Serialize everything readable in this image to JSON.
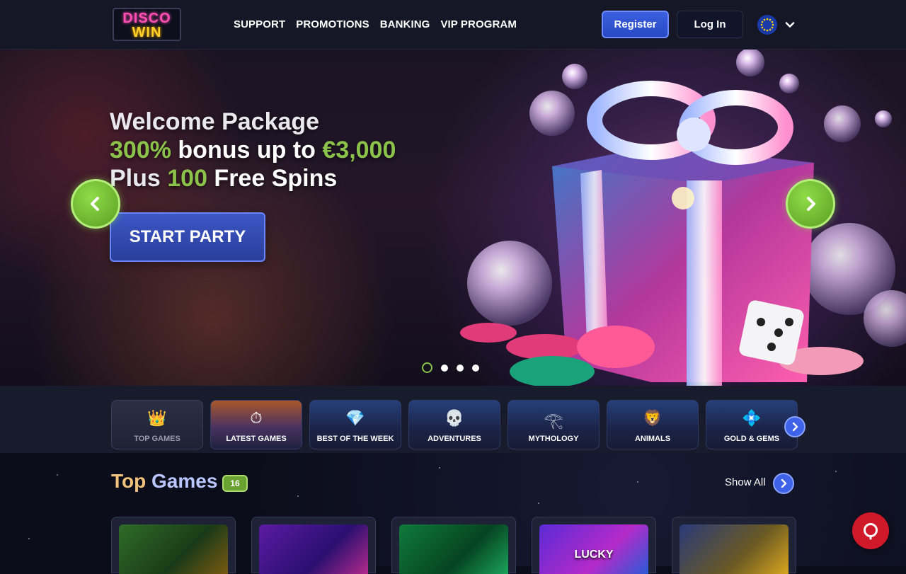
{
  "header": {
    "logo_line1": "DISCO",
    "logo_line2": "WIN",
    "nav": [
      "SUPPORT",
      "PROMOTIONS",
      "BANKING",
      "VIP PROGRAM"
    ],
    "register_label": "Register",
    "login_label": "Log In",
    "language_icon": "eu-flag-icon"
  },
  "hero": {
    "line1": "Welcome Package",
    "line2_highlight": "300%",
    "line2_text": " bonus up to ",
    "line2_amount": "€3,000",
    "line3_text": "Plus ",
    "line3_highlight": "100",
    "line3_rest": " Free Spins",
    "cta_label": "START PARTY",
    "slide_count": 4,
    "active_slide": 1
  },
  "categories": [
    {
      "label": "TOP GAMES",
      "icon": "crown-icon",
      "glyph": "👑"
    },
    {
      "label": "LATEST GAMES",
      "icon": "stopwatch-icon",
      "glyph": "⏱"
    },
    {
      "label": "BEST OF THE WEEK",
      "icon": "diamond-icon",
      "glyph": "💎"
    },
    {
      "label": "ADVENTURES",
      "icon": "pirate-skull-icon",
      "glyph": "💀"
    },
    {
      "label": "MYTHOLOGY",
      "icon": "pharaoh-icon",
      "glyph": "𓂀"
    },
    {
      "label": "ANIMALS",
      "icon": "lion-icon",
      "glyph": "🦁"
    },
    {
      "label": "GOLD & GEMS",
      "icon": "gems-icon",
      "glyph": "💠"
    }
  ],
  "top_games": {
    "title_part1": "Top",
    "title_part2": "Games",
    "count": "16",
    "show_all_label": "Show All",
    "games": [
      {
        "name": "",
        "thumb_class": "g1"
      },
      {
        "name": "",
        "thumb_class": "g2"
      },
      {
        "name": "",
        "thumb_class": "g3"
      },
      {
        "name": "LUCKY",
        "thumb_class": "g4"
      },
      {
        "name": "",
        "thumb_class": "g5"
      }
    ]
  },
  "colors": {
    "accent_green": "#8bc34a",
    "accent_blue": "#3e63e8",
    "chat_red": "#d0182b",
    "header_bg": "#151726"
  }
}
